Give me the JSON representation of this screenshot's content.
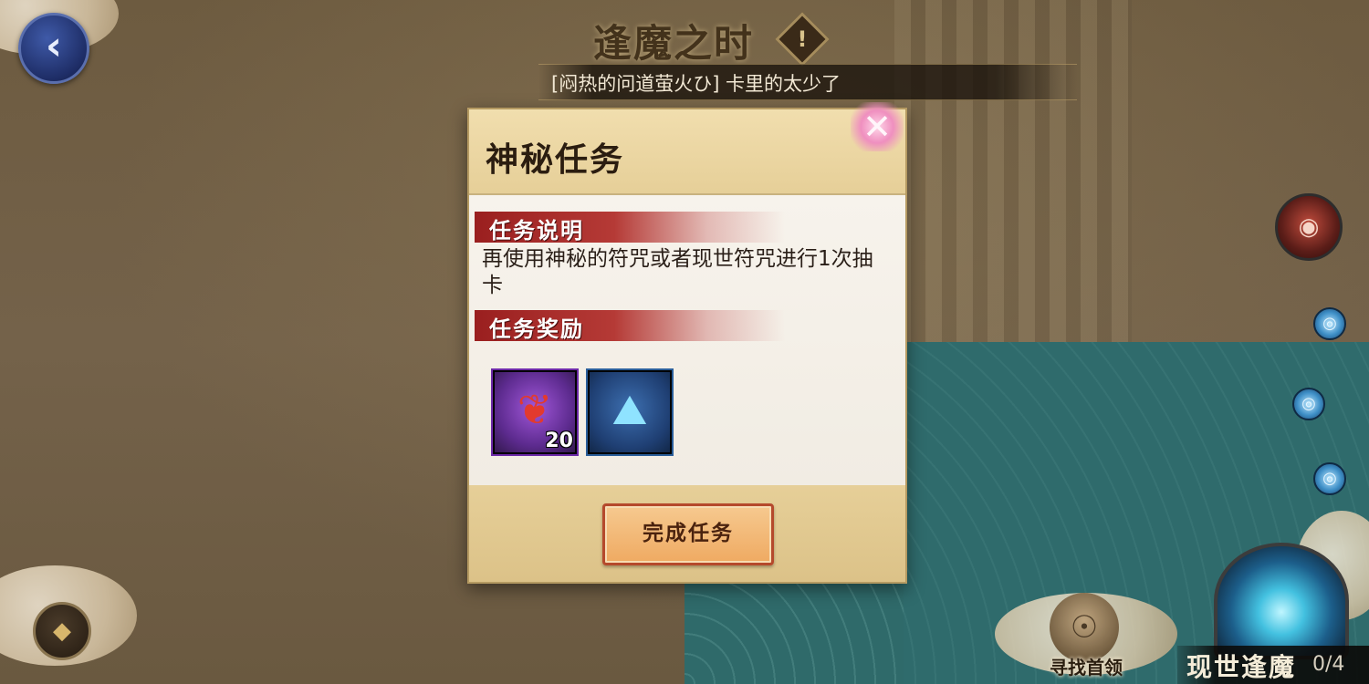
{
  "event": {
    "title": "逢魔之时",
    "info_glyph": "!",
    "marquee": "[闷热的问道萤火ひ] 卡里的太少了"
  },
  "nav": {
    "back_glyph": "‹"
  },
  "dialog": {
    "title": "神秘任务",
    "close_glyph": "✕",
    "description_header": "任务说明",
    "description": "再使用神秘的符咒或者现世符咒进行1次抽卡",
    "reward_header": "任务奖励",
    "rewards": [
      {
        "icon": "magatama-charm-icon",
        "glyph": "❦",
        "quantity": "20",
        "frame_color": "#6d2aa8"
      },
      {
        "icon": "blue-stone-altar-icon",
        "glyph": "⛰",
        "quantity": "",
        "frame_color": "#2a5e9a"
      }
    ],
    "complete_button": "完成任务"
  },
  "map": {
    "boss_glyph": "◉",
    "path_glyph": "◎",
    "compass_glyph": "◆",
    "leader_label": "寻找首领",
    "leader_glyph": "☉",
    "portal_title": "现世逢魔",
    "portal_count": "0/4"
  },
  "colors": {
    "accent_red": "#9a1f1f",
    "button_orange": "#efaa62",
    "parchment": "#eedcae"
  }
}
